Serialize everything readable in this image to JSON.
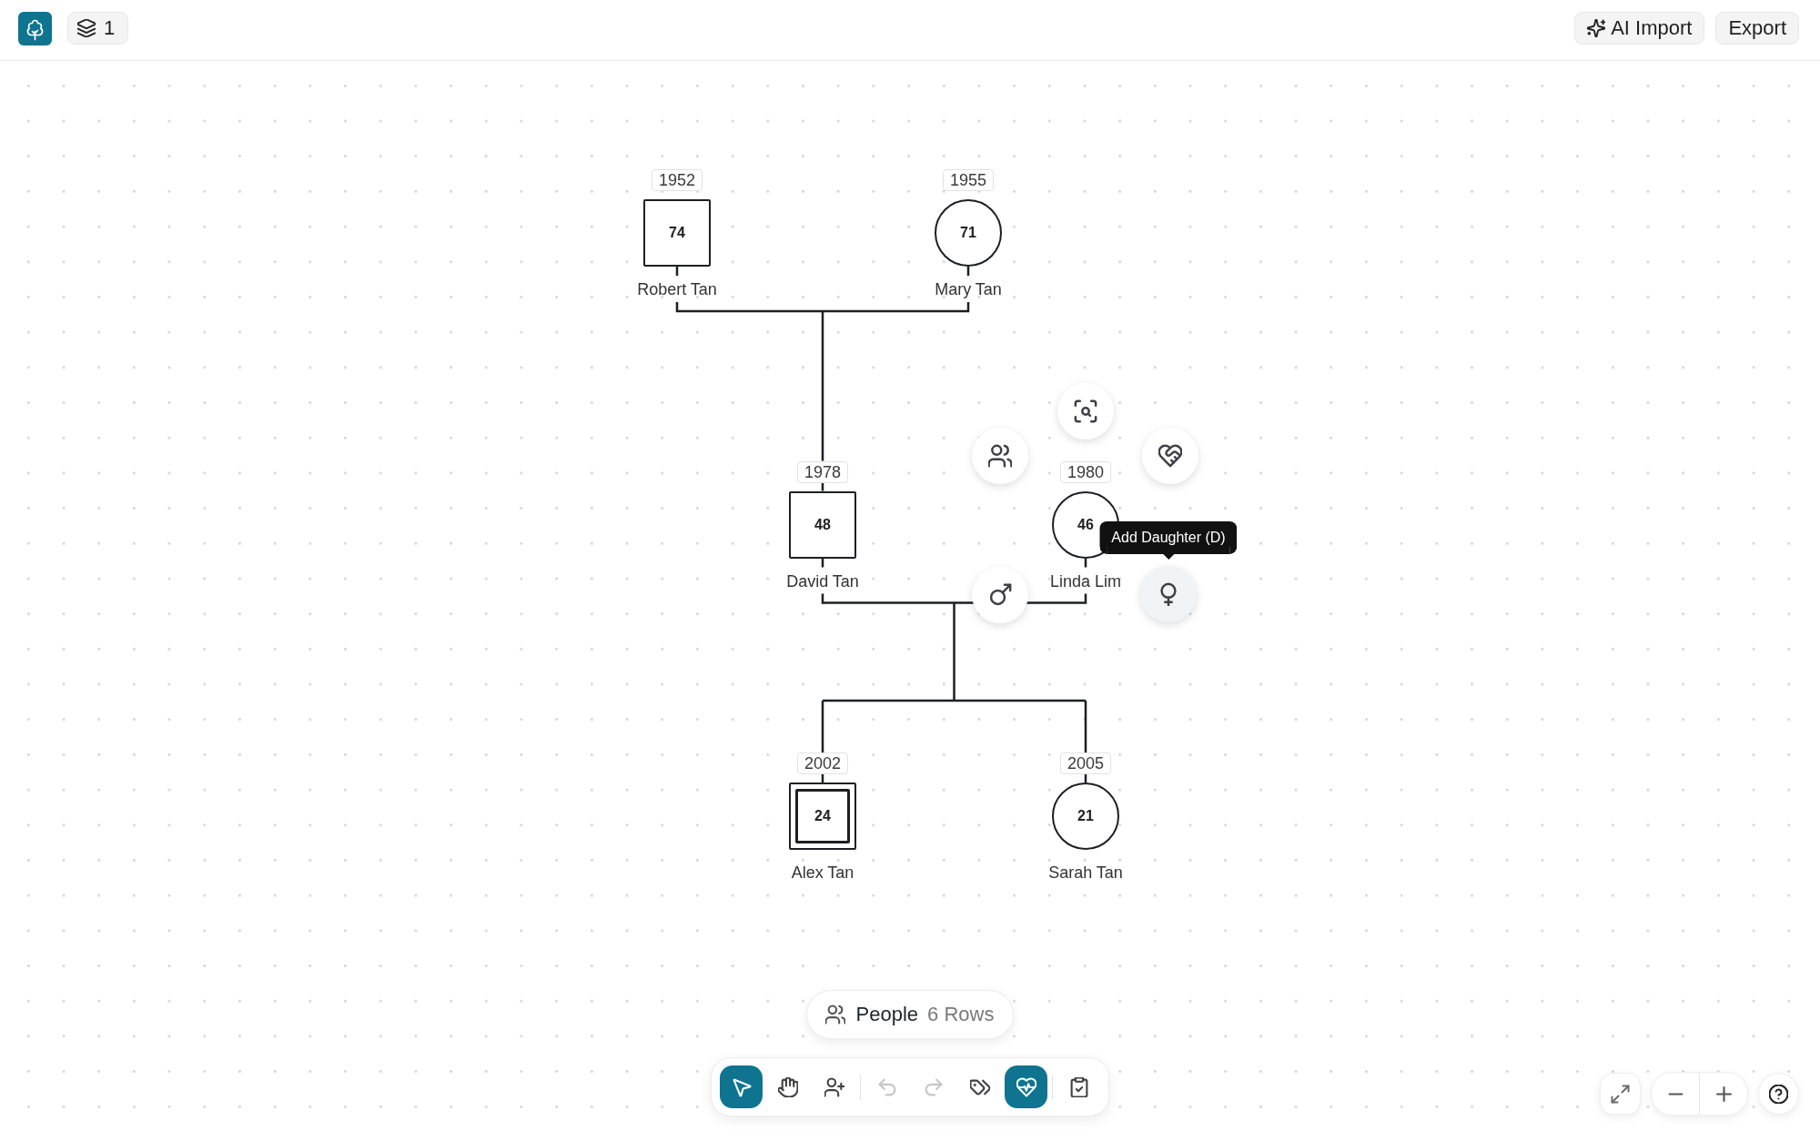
{
  "top_bar": {
    "layers_count": "1",
    "buttons": [
      {
        "kind": "ai-import",
        "label": "AI Import"
      },
      {
        "kind": "export",
        "label": "Export"
      }
    ]
  },
  "pedigree": {
    "partners": [
      {
        "name": "Robert Tan",
        "birth_year": "1952",
        "age": "74",
        "kind": "male",
        "proband": false
      },
      {
        "name": "Mary Tan",
        "birth_year": "1955",
        "age": "71",
        "kind": "female",
        "proband": false
      }
    ],
    "children": [
      {
        "name": "David Tan",
        "birth_year": "1978",
        "age": "48",
        "kind": "male",
        "proband": false,
        "partner": {
          "name": "Linda Lim",
          "birth_year": "1980",
          "age": "46",
          "kind": "female",
          "proband": false,
          "actions": [
            {
              "kind": "focus",
              "hovered": false
            },
            {
              "kind": "relatives",
              "hovered": false
            },
            {
              "kind": "partner",
              "hovered": false
            },
            {
              "kind": "son",
              "hovered": false
            },
            {
              "kind": "daughter",
              "hovered": true,
              "tooltip": "Add Daughter (D)"
            }
          ]
        },
        "children": [
          {
            "name": "Alex Tan",
            "birth_year": "2002",
            "age": "24",
            "kind": "male",
            "proband": true
          },
          {
            "name": "Sarah Tan",
            "birth_year": "2005",
            "age": "21",
            "kind": "female",
            "proband": false
          }
        ]
      }
    ]
  },
  "people_panel": {
    "label": "People",
    "count": "6 Rows"
  },
  "tool_groups": [
    [
      {
        "kind": "select",
        "on": true,
        "disabled": false
      },
      {
        "kind": "pan",
        "on": false,
        "disabled": false
      },
      {
        "kind": "add-person",
        "on": false,
        "disabled": false
      }
    ],
    [
      {
        "kind": "undo",
        "on": false,
        "disabled": true
      },
      {
        "kind": "redo",
        "on": false,
        "disabled": true
      },
      {
        "kind": "tags",
        "on": false,
        "disabled": false
      },
      {
        "kind": "health",
        "on": true,
        "disabled": false
      }
    ],
    [
      {
        "kind": "checklist",
        "on": false,
        "disabled": false
      }
    ]
  ]
}
